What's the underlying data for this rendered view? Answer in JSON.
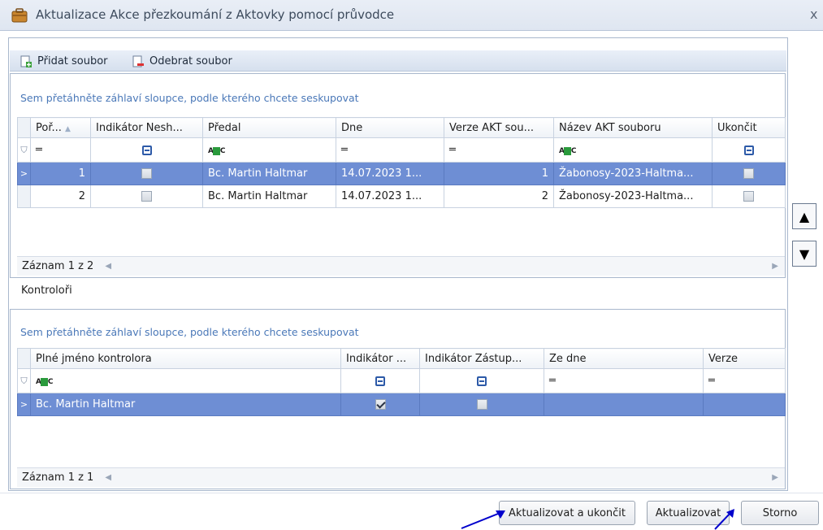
{
  "window": {
    "title": "Aktualizace Akce přezkoumání z Aktovky pomocí průvodce",
    "close_glyph": "x"
  },
  "toolbar": {
    "add_label": "Přidat soubor",
    "remove_label": "Odebrat soubor"
  },
  "files_grid": {
    "group_hint": "Sem přetáhněte záhlaví sloupce, podle kterého chcete seskupovat",
    "columns": [
      "Poř...",
      "Indikátor Nesh...",
      "Předal",
      "Dne",
      "Verze AKT sou...",
      "Název AKT souboru",
      "Ukončit"
    ],
    "rows": [
      {
        "order": "1",
        "checked": false,
        "handed_by": "Bc. Martin Haltmar",
        "date": "14.07.2023 1...",
        "version": "1",
        "file_name": "Žabonosy-2023-Haltma...",
        "close": false
      },
      {
        "order": "2",
        "checked": false,
        "handed_by": "Bc. Martin Haltmar",
        "date": "14.07.2023 1...",
        "version": "2",
        "file_name": "Žabonosy-2023-Haltma...",
        "close": false
      }
    ],
    "footer": "Záznam 1 z 2"
  },
  "controllers_label": "Kontroloři",
  "controllers_grid": {
    "group_hint": "Sem přetáhněte záhlaví sloupce, podle kterého chcete seskupovat",
    "columns": [
      "Plné jméno kontrolora",
      "Indikátor ...",
      "Indikátor Zástup...",
      "Ze dne",
      "Verze"
    ],
    "rows": [
      {
        "name": "Bc. Martin Haltmar",
        "indicator": true,
        "substitute": false,
        "from_date": "",
        "version": ""
      }
    ],
    "footer": "Záznam 1 z 1"
  },
  "buttons": {
    "update_close": "Aktualizovat a ukončit",
    "update": "Aktualizovat",
    "cancel": "Storno"
  },
  "colors": {
    "selection": "#6e8ed4",
    "annotation_arrow": "#0000cc"
  }
}
